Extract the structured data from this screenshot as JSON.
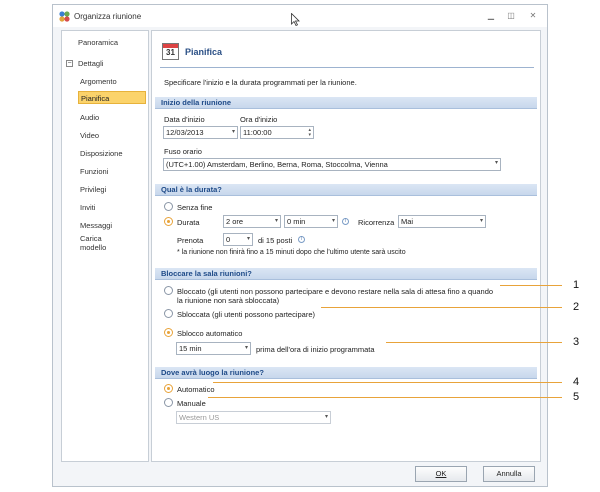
{
  "window": {
    "title": "Organizza riunione"
  },
  "sidebar": {
    "items": [
      {
        "label": "Panoramica"
      },
      {
        "label": "Dettagli"
      },
      {
        "label": "Argomento"
      },
      {
        "label": "Pianifica"
      },
      {
        "label": "Audio"
      },
      {
        "label": "Video"
      },
      {
        "label": "Disposizione"
      },
      {
        "label": "Funzioni"
      },
      {
        "label": "Privilegi"
      },
      {
        "label": "Inviti"
      },
      {
        "label": "Messaggi"
      },
      {
        "label": "Carica\nmodello"
      }
    ],
    "expander": "⊟"
  },
  "main": {
    "title": "Pianifica",
    "calendar_icon_number": "31",
    "description": "Specificare l'inizio e la durata programmati per la riunione.",
    "start": {
      "section": "Inizio della riunione",
      "date_label": "Data d'inizio",
      "date_value": "12/03/2013",
      "time_label": "Ora d'inizio",
      "time_value": "11:00:00",
      "tz_label": "Fuso orario",
      "tz_value": "(UTC+1.00) Amsterdam, Berlino, Berna, Roma, Stoccolma, Vienna"
    },
    "duration": {
      "section": "Qual è la durata?",
      "no_end": "Senza fine",
      "duration_label": "Durata",
      "hours_value": "2 ore",
      "minutes_value": "0 min",
      "recurrence_label": "Ricorrenza",
      "recurrence_value": "Mai",
      "booking_label": "Prenota",
      "booking_value": "0",
      "booking_suffix": "di 15 posti",
      "note": "* la riunione non finirà fino a 15 minuti dopo che l'ultimo utente sarà uscito"
    },
    "lock": {
      "section": "Bloccare la sala riunioni?",
      "locked_line1": "Bloccato (gli utenti non possono partecipare e devono restare nella sala di attesa fino a quando",
      "locked_line2": "la riunione non sarà sbloccata)",
      "unlocked": "Sbloccata (gli utenti possono partecipare)",
      "auto_unlock": "Sblocco automatico",
      "auto_value": "15 min",
      "auto_suffix": "prima dell'ora di inizio programmata"
    },
    "location": {
      "section": "Dove avrà luogo la riunione?",
      "automatic": "Automatico",
      "manual": "Manuale",
      "manual_value": "Western US"
    }
  },
  "buttons": {
    "ok": "OK",
    "cancel": "Annulla"
  },
  "callouts": [
    "1",
    "2",
    "3",
    "4",
    "5"
  ],
  "colors": {
    "accent": "#e8a33a",
    "section_text": "#1e4a88",
    "selected_item": "#fbd36b"
  }
}
